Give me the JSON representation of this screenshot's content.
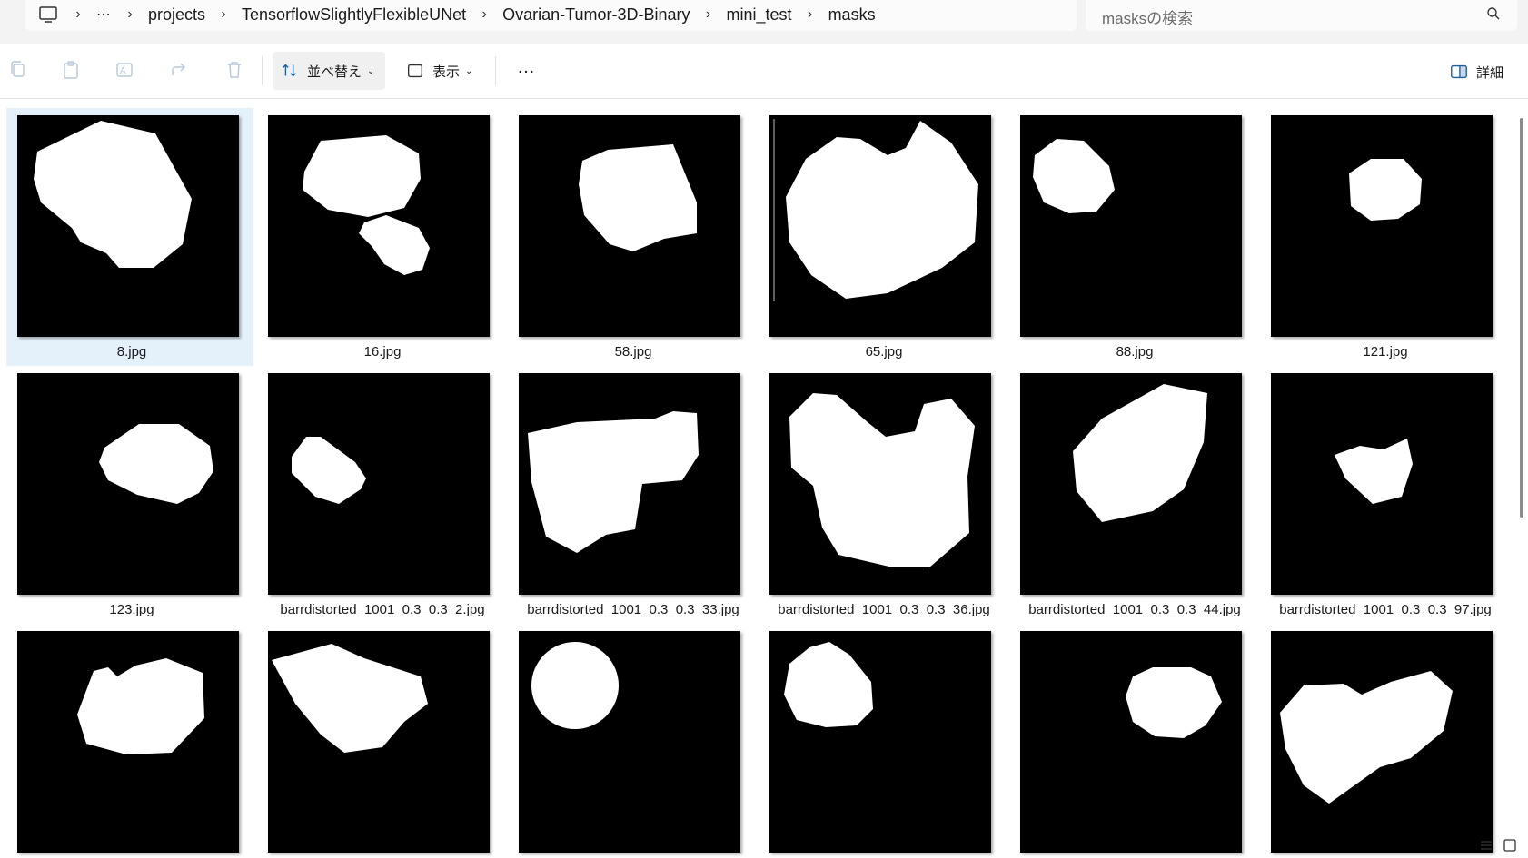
{
  "breadcrumb": {
    "items": [
      "projects",
      "TensorflowSlightlyFlexibleUNet",
      "Ovarian-Tumor-3D-Binary",
      "mini_test",
      "masks"
    ],
    "overflow": "⋯"
  },
  "search": {
    "placeholder": "masksの検索"
  },
  "toolbar": {
    "sort_label": "並べ替え",
    "view_label": "表示",
    "more": "…",
    "details_label": "詳細"
  },
  "files": [
    {
      "name": "8.jpg",
      "selected": true
    },
    {
      "name": "16.jpg"
    },
    {
      "name": "58.jpg"
    },
    {
      "name": "65.jpg"
    },
    {
      "name": "88.jpg"
    },
    {
      "name": "121.jpg"
    },
    {
      "name": "123.jpg"
    },
    {
      "name": "barrdistorted_1001_0.3_0.3_2.jpg"
    },
    {
      "name": "barrdistorted_1001_0.3_0.3_33.jpg"
    },
    {
      "name": "barrdistorted_1001_0.3_0.3_36.jpg"
    },
    {
      "name": "barrdistorted_1001_0.3_0.3_44.jpg"
    },
    {
      "name": "barrdistorted_1001_0.3_0.3_97.jpg"
    },
    {
      "name": ""
    },
    {
      "name": ""
    },
    {
      "name": ""
    },
    {
      "name": ""
    },
    {
      "name": ""
    },
    {
      "name": ""
    }
  ],
  "colors": {
    "selection": "#e4f1fb",
    "thumbnail_bg": "#000000",
    "mask": "#ffffff"
  }
}
